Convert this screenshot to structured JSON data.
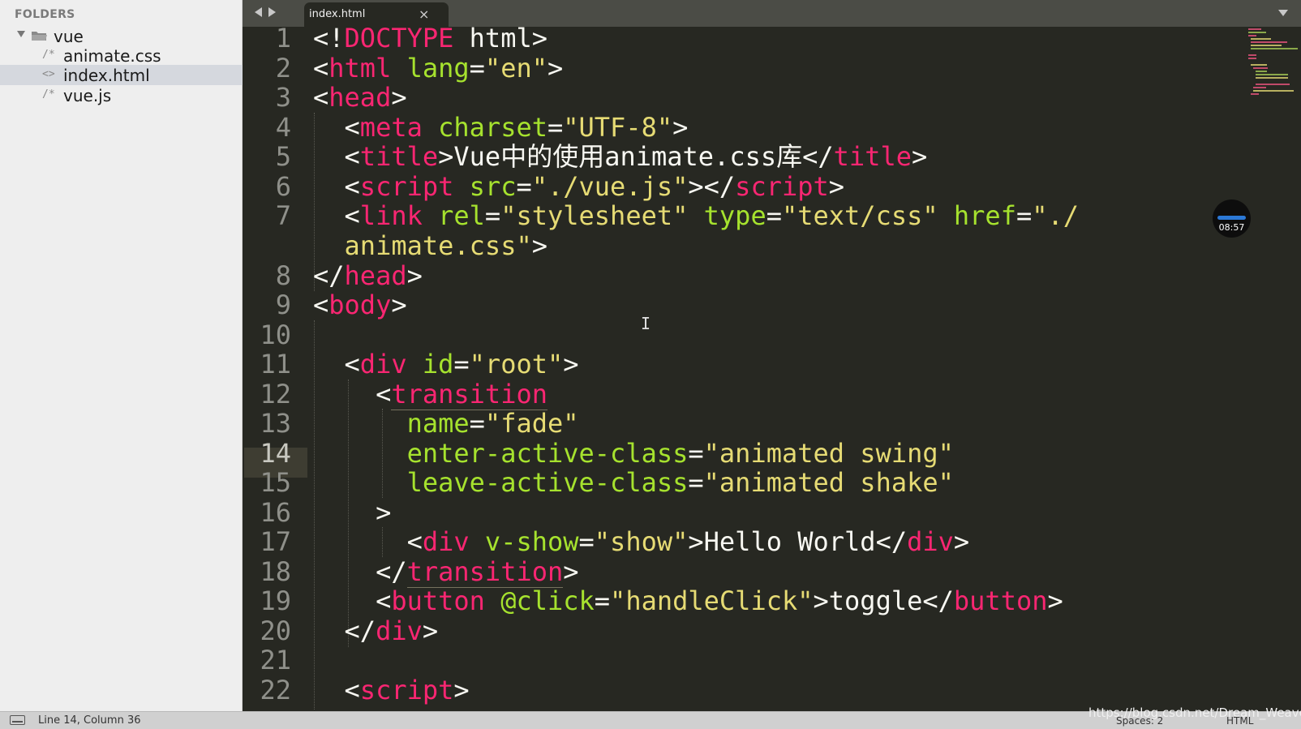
{
  "sidebar": {
    "title": "FOLDERS",
    "folder": "vue",
    "files": [
      {
        "name": "animate.css",
        "icon": "/*",
        "selected": false
      },
      {
        "name": "index.html",
        "icon": "<>",
        "selected": true
      },
      {
        "name": "vue.js",
        "icon": "/*",
        "selected": false
      }
    ]
  },
  "tabs": [
    {
      "label": "index.html",
      "close": "×",
      "active": true
    }
  ],
  "editor": {
    "line_numbers": [
      "1",
      "2",
      "3",
      "4",
      "5",
      "6",
      "7",
      "",
      "8",
      "9",
      "10",
      "11",
      "12",
      "13",
      "14",
      "15",
      "16",
      "17",
      "18",
      "19",
      "20",
      "21",
      "22"
    ],
    "current_line": "14"
  },
  "overlay": {
    "timer": "08:57",
    "watermark": "https://blog.csdn.net/Dream_Weave"
  },
  "status": {
    "position": "Line 14, Column 36",
    "spaces": "Spaces: 2",
    "syntax": "HTML"
  },
  "colors": {
    "tag": "#f92672",
    "attribute": "#a6e22e",
    "string": "#e6db74",
    "text": "#f8f8f2",
    "background": "#272822",
    "line_number": "#8f908a"
  }
}
